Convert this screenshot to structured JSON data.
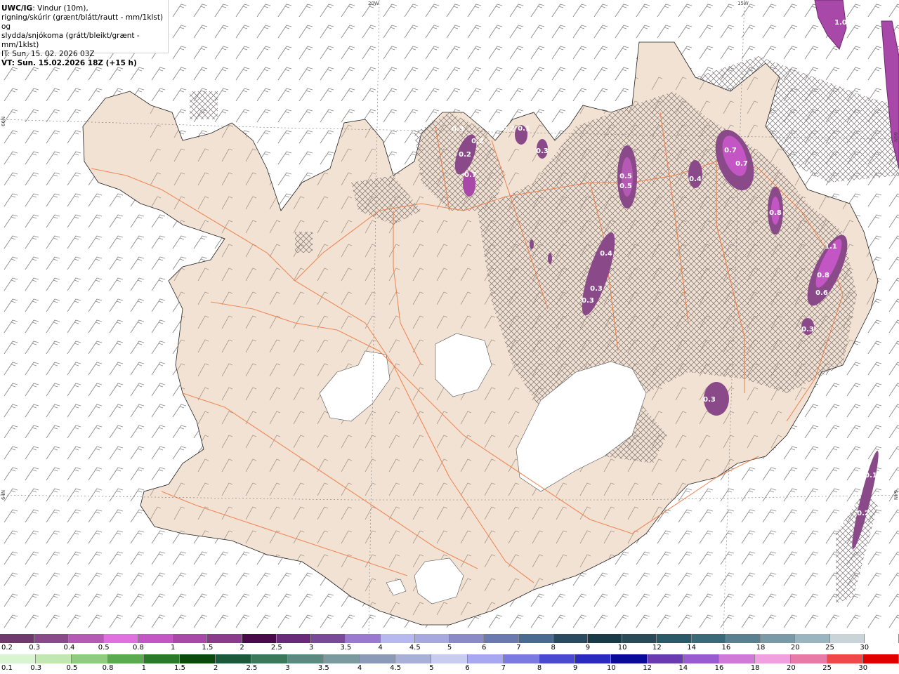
{
  "header": {
    "line1_bold": "UWC/IG",
    "line1_rest": ": Vindur (10m),",
    "line2": "rigning/skúrir (grænt/blátt/rautt - mm/1klst) og",
    "line3": "slydda/snjókoma (grátt/bleikt/grænt - mm/1klst)",
    "line4": "IT: Sun. 15. 02. 2026 03Z",
    "line5": "VT: Sun. 15.02.2026 18Z (+15 h)"
  },
  "graticule_labels": {
    "top_20w": "20W",
    "top_15w": "15W",
    "left_66n": "66N",
    "left_64n": "64N",
    "right_66n": "66N",
    "right_64n": "64N"
  },
  "precip_labels": [
    "1.0",
    "0.3",
    "0.2",
    "0.2",
    "0.7",
    "0.2",
    "0.1",
    "0.3",
    "0.7",
    "0.7",
    "0.5",
    "0.5",
    "0.4",
    "0.8",
    "1.1",
    "0.8",
    "0.6",
    "0.3",
    "0.4",
    "0.3",
    "0.3",
    "0.3",
    "0.1",
    "0.2"
  ],
  "snow_legend": {
    "values": [
      "0.2",
      "0.3",
      "0.4",
      "0.5",
      "0.8",
      "1",
      "1.5",
      "2",
      "2.5",
      "3",
      "3.5",
      "4",
      "4.5",
      "5",
      "6",
      "7",
      "8",
      "9",
      "10",
      "12",
      "14",
      "16",
      "18",
      "20",
      "25",
      "30"
    ],
    "colors": [
      "#6e3a6e",
      "#8a4a8a",
      "#b45ab4",
      "#e070e0",
      "#c455c4",
      "#a848a8",
      "#8c3a8c",
      "#4a0a4a",
      "#6a2a7a",
      "#7a4a9a",
      "#9a7ad0",
      "#b8b8f0",
      "#a8a8e0",
      "#8a8ac8",
      "#6a7ab0",
      "#4a6a90",
      "#2a4a60",
      "#1a3a48",
      "#2a4a58",
      "#2a5a68",
      "#3a6a78",
      "#5a8090",
      "#7a9aa8",
      "#9ab4c0",
      "#c8d4d8",
      "#ffffff"
    ]
  },
  "rain_legend": {
    "values": [
      "0.1",
      "0.3",
      "0.5",
      "0.8",
      "1",
      "1.5",
      "2",
      "2.5",
      "3",
      "3.5",
      "4",
      "4.5",
      "5",
      "6",
      "7",
      "8",
      "9",
      "10",
      "12",
      "14",
      "16",
      "18",
      "20",
      "25",
      "30"
    ],
    "colors": [
      "#d8f4d0",
      "#c0e8b0",
      "#90cc80",
      "#5aaa50",
      "#2a7a2a",
      "#0a4a0a",
      "#1a5a3a",
      "#3a7a5a",
      "#5a8a80",
      "#7a9aa0",
      "#8a9ab8",
      "#a8b0d8",
      "#c8ccf0",
      "#a8a8f0",
      "#7a7ae0",
      "#4a4ad0",
      "#2a2ac0",
      "#0a0a9a",
      "#6a3ab0",
      "#9a5ad0",
      "#d07ad8",
      "#f0a0e0",
      "#e87aa8",
      "#f04848",
      "#e00000"
    ]
  }
}
